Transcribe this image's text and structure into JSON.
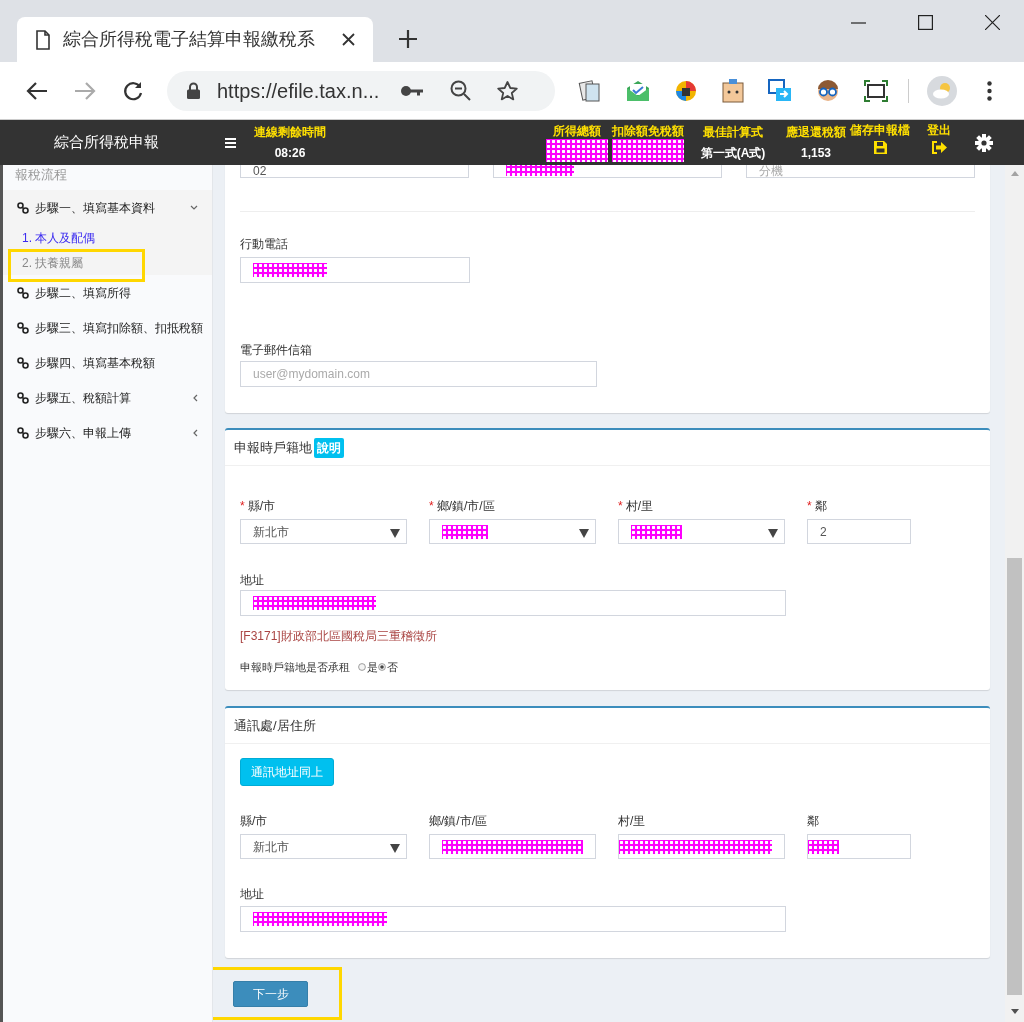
{
  "browser": {
    "tab_title": "綜合所得稅電子結算申報繳稅系",
    "url": "https://efile.tax.n..."
  },
  "app_header": {
    "title": "綜合所得稅申報",
    "stats": [
      {
        "label": "連線剩餘時間",
        "value": "08:26"
      },
      {
        "label": "所得總額",
        "redacted": true
      },
      {
        "label": "扣除額免稅額",
        "redacted": true
      },
      {
        "label": "最佳計算式",
        "value": "第一式(A式)"
      },
      {
        "label": "應退還稅額",
        "value": "1,153"
      }
    ],
    "actions": [
      {
        "label": "儲存申報檔",
        "kind": "save"
      },
      {
        "label": "登出",
        "kind": "logout"
      }
    ]
  },
  "sidebar": {
    "heading": "報稅流程",
    "items": [
      {
        "label": "步驟一、填寫基本資料",
        "kind": "group",
        "expanded": true,
        "children": [
          {
            "label": "1. 本人及配偶",
            "selected": true,
            "highlighted": false
          },
          {
            "label": "2. 扶養親屬",
            "selected": false,
            "highlighted": true
          }
        ]
      },
      {
        "label": "步驟二、填寫所得",
        "kind": "link"
      },
      {
        "label": "步驟三、填寫扣除額、扣抵稅額",
        "kind": "link"
      },
      {
        "label": "步驟四、填寫基本稅額",
        "kind": "link"
      },
      {
        "label": "步驟五、稅額計算",
        "kind": "group",
        "expanded": false
      },
      {
        "label": "步驟六、申報上傳",
        "kind": "group",
        "expanded": false
      }
    ]
  },
  "contact_section": {
    "top_fields": [
      {
        "value": "02"
      },
      {
        "redacted": true
      },
      {
        "placeholder": "分機"
      }
    ],
    "mobile": {
      "label": "行動電話",
      "redacted": true
    },
    "email": {
      "label": "電子郵件信箱",
      "placeholder": "user@mydomain.com"
    }
  },
  "household_section": {
    "title": "申報時戶籍地",
    "help_badge": "說明",
    "fields": [
      {
        "label": "縣/市",
        "required_mark": "*",
        "kind": "select",
        "value": "新北市"
      },
      {
        "label": "鄉/鎮/市/區",
        "required_mark": "*",
        "kind": "select",
        "redacted": true
      },
      {
        "label": "村/里",
        "required_mark": "*",
        "kind": "select",
        "redacted": true
      },
      {
        "label": "鄰",
        "required_mark": "*",
        "kind": "text",
        "value": "2"
      }
    ],
    "address": {
      "label": "地址",
      "redacted": true
    },
    "office_note": "[F3171]財政部北區國稅局三重稽徵所",
    "rented_question": {
      "label": "申報時戶籍地是否承租",
      "options": [
        {
          "label": "是",
          "selected": false
        },
        {
          "label": "否",
          "selected": true
        }
      ]
    }
  },
  "mailing_section": {
    "title": "通訊處/居住所",
    "copy_button": "通訊地址同上",
    "fields": [
      {
        "label": "縣/市",
        "kind": "select",
        "value": "新北市"
      },
      {
        "label": "鄉/鎮/市/區",
        "kind": "text",
        "redacted": true
      },
      {
        "label": "村/里",
        "kind": "text",
        "redacted": true
      },
      {
        "label": "鄰",
        "kind": "text",
        "redacted": true
      }
    ],
    "address": {
      "label": "地址",
      "redacted": true
    }
  },
  "next_button": {
    "label": "下一步",
    "highlighted": true
  }
}
